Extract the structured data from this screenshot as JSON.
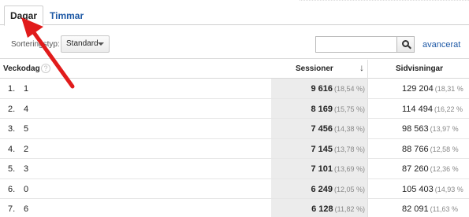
{
  "tabs": [
    {
      "label": "Dagar",
      "active": true
    },
    {
      "label": "Timmar",
      "active": false
    }
  ],
  "toolbar": {
    "sort_label": "Sorteringstyp:",
    "sort_value": "Standard",
    "search_value": "",
    "advanced_label": "avancerat"
  },
  "table": {
    "columns": {
      "day": "Veckodag",
      "help": "?",
      "sessions": "Sessioner",
      "sort_indicator": "↓",
      "pageviews": "Sidvisningar"
    },
    "rows": [
      {
        "index": "1.",
        "day": "1",
        "sessions": "9 616",
        "sessions_pct": "(18,54 %)",
        "pageviews": "129 204",
        "pageviews_pct": "(18,31 %"
      },
      {
        "index": "2.",
        "day": "4",
        "sessions": "8 169",
        "sessions_pct": "(15,75 %)",
        "pageviews": "114 494",
        "pageviews_pct": "(16,22 %"
      },
      {
        "index": "3.",
        "day": "5",
        "sessions": "7 456",
        "sessions_pct": "(14,38 %)",
        "pageviews": "98 563",
        "pageviews_pct": "(13,97 %"
      },
      {
        "index": "4.",
        "day": "2",
        "sessions": "7 145",
        "sessions_pct": "(13,78 %)",
        "pageviews": "88 766",
        "pageviews_pct": "(12,58 %"
      },
      {
        "index": "5.",
        "day": "3",
        "sessions": "7 101",
        "sessions_pct": "(13,69 %)",
        "pageviews": "87 260",
        "pageviews_pct": "(12,36 %"
      },
      {
        "index": "6.",
        "day": "0",
        "sessions": "6 249",
        "sessions_pct": "(12,05 %)",
        "pageviews": "105 403",
        "pageviews_pct": "(14,93 %"
      },
      {
        "index": "7.",
        "day": "6",
        "sessions": "6 128",
        "sessions_pct": "(11,82 %)",
        "pageviews": "82 091",
        "pageviews_pct": "(11,63 %"
      }
    ]
  },
  "colors": {
    "link": "#1f5aa6",
    "arrow": "#e11b1b",
    "highlight_column": "#ececec"
  }
}
